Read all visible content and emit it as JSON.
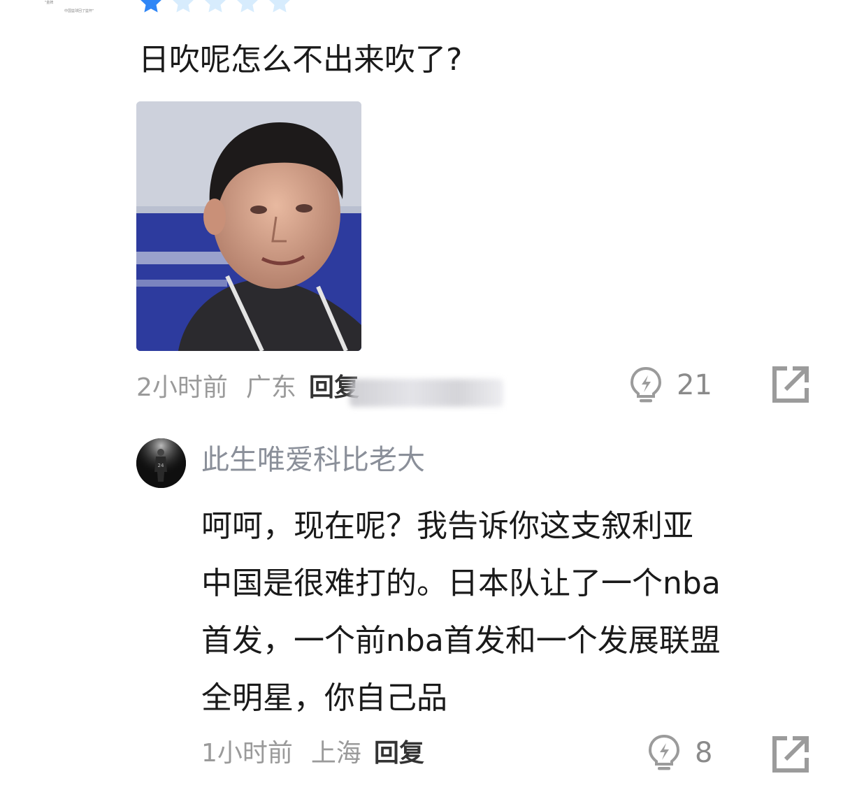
{
  "thumbnail": {
    "line1": "\"金牌",
    "line2": "中国篮球回了篮怀\""
  },
  "rating": {
    "value": 1,
    "max": 5,
    "filled_color": "#2f86f6",
    "empty_color": "#d7ecfd"
  },
  "comment1": {
    "text": "日吹呢怎么不出来吹了?",
    "image_icon": "photo-man-icon",
    "time": "2小时前",
    "location": "广东",
    "reply_label": "回复",
    "likes": "21"
  },
  "comment2": {
    "username": "此生唯爱科比老大",
    "avatar_icon": "basketball-player-avatar",
    "lines": [
      "呵呵，现在呢？我告诉你这支叙利亚",
      "中国是很难打的。日本队让了一个nba",
      "首发，一个前nba首发和一个发展联盟",
      "全明星，你自己品"
    ],
    "time": "1小时前",
    "location": "上海",
    "reply_label": "回复",
    "likes": "8"
  },
  "colors": {
    "icon_gray": "#9b9b9b",
    "meta_gray": "#9a9a9a",
    "username": "#8a8f99"
  }
}
